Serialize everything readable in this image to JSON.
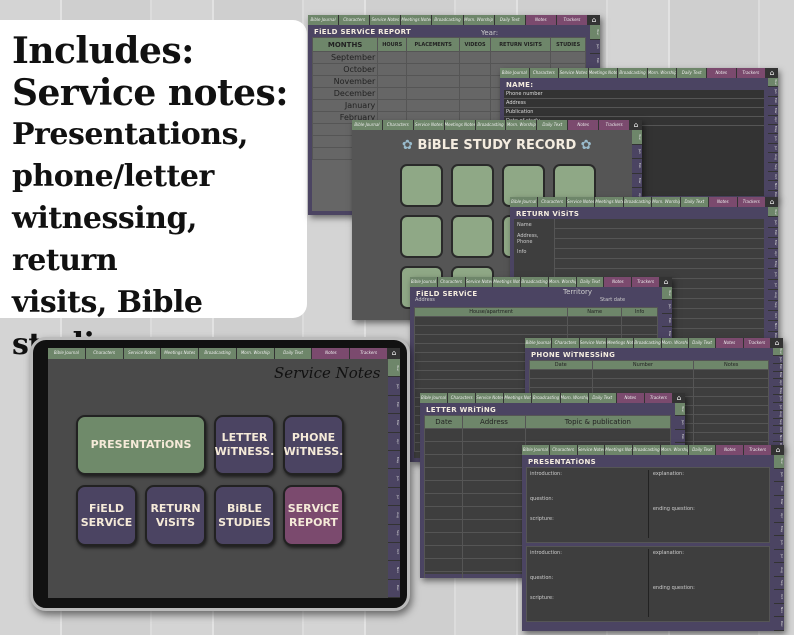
{
  "callout": {
    "lines": [
      "Includes:",
      "Service notes:",
      "Presentations,",
      "phone/letter",
      "witnessing, return",
      "visits, Bible",
      "studies..."
    ]
  },
  "tabs": [
    "Bible Journal",
    "Characters",
    "Service Notes",
    "Meetings Notes",
    "Broadcasting",
    "Morn. Worship",
    "Daily Text",
    "Notes",
    "Trackers"
  ],
  "side_tabs": [
    "Year",
    "Jan",
    "Feb",
    "Mar",
    "Apr",
    "May",
    "Jun",
    "Jul",
    "Aug",
    "Sep",
    "Oct",
    "Nov",
    "Dec"
  ],
  "home_icon": "home-icon",
  "colors": {
    "green": "#6f8a6a",
    "purple": "#4b4462",
    "rose": "#7b4a6e",
    "background": "#4a4a4a"
  },
  "report": {
    "title": "FiELD SERViCE REPORT",
    "year_label": "Year:",
    "columns": [
      "MONTHS",
      "HOURS",
      "PLACEMENTS",
      "VIDEOS",
      "RETURN VISITS",
      "STUDIES"
    ],
    "months": [
      "September",
      "October",
      "November",
      "December",
      "January",
      "February"
    ]
  },
  "name_page": {
    "title": "NAME:",
    "fields": [
      "Phone number",
      "Address",
      "Publication",
      "Date of study"
    ]
  },
  "bible_study": {
    "title": "BiBLE STUDY RECORD"
  },
  "return_visits": {
    "title": "RETURN ViSiTS",
    "fields": [
      "Name",
      "Address, Phone",
      "Info"
    ]
  },
  "field_service": {
    "title": "FiELD SERViCE",
    "territory": "Territory",
    "address": "Address",
    "start_date": "Start date",
    "columns": [
      "House/apartment",
      "Name",
      "Info"
    ]
  },
  "phone": {
    "title": "PHONE WiTNESSiNG",
    "columns": [
      "Date",
      "Number",
      "Notes"
    ]
  },
  "letter": {
    "title": "LETTER WRiTiNG",
    "columns": [
      "Date",
      "Address",
      "Topic & publication"
    ]
  },
  "presentations": {
    "title": "PRESENTATiONS",
    "fields": [
      "introduction:",
      "question:",
      "scripture:",
      "explanation:",
      "ending question:"
    ]
  },
  "tablet": {
    "title": "Service Notes",
    "buttons": [
      "PRESENTATiONS",
      "LETTER\nWiTNESS.",
      "PHONE\nWiTNESS.",
      "FiELD\nSERViCE",
      "RETURN\nViSiTS",
      "BiBLE\nSTUDiES",
      "SERViCE\nREPORT"
    ]
  }
}
